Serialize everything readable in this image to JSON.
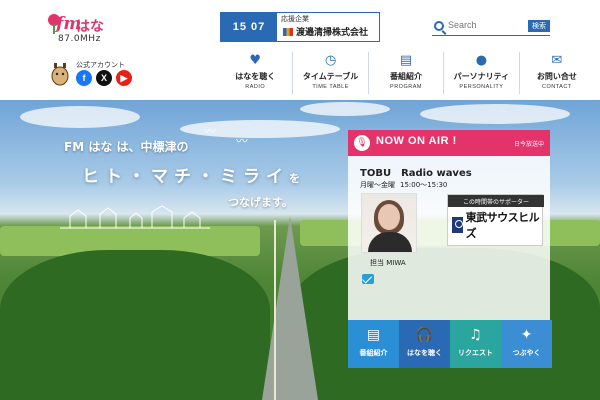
{
  "header": {
    "logo": {
      "brand": "fm",
      "name": "はな",
      "frequency": "87.0MHz"
    },
    "social_label": "公式アカウント",
    "social": [
      {
        "icon": "facebook-icon",
        "glyph": "f",
        "color": "#1877f2"
      },
      {
        "icon": "x-icon",
        "glyph": "X",
        "color": "#111111"
      },
      {
        "icon": "youtube-icon",
        "glyph": "▶",
        "color": "#e62117"
      }
    ],
    "sponsor": {
      "time": "15 07",
      "label": "応援企業",
      "name": "渡邉清掃株式会社"
    },
    "search": {
      "placeholder": "Search",
      "button": "検索"
    },
    "nav": [
      {
        "icon": "heart-icon",
        "glyph": "♥",
        "label": "はなを聴く",
        "sub": "RADIO"
      },
      {
        "icon": "clock-icon",
        "glyph": "◷",
        "label": "タイムテーブル",
        "sub": "TIME TABLE"
      },
      {
        "icon": "program-icon",
        "glyph": "▤",
        "label": "番組紹介",
        "sub": "PROGRAM"
      },
      {
        "icon": "person-icon",
        "glyph": "●",
        "label": "パーソナリティ",
        "sub": "PERSONALITY"
      },
      {
        "icon": "mail-icon",
        "glyph": "✉",
        "label": "お問い合せ",
        "sub": "CONTACT"
      }
    ]
  },
  "hero": {
    "tagline1": "FM はな は、中標津の",
    "tagline2": "ヒト・マチ・ミライ",
    "tagline2_suffix": "を",
    "tagline3": "つなげます。"
  },
  "onair": {
    "title": "NOW ON AIR !",
    "today": "日今放送中",
    "program": "TOBU　Radio waves",
    "days": "月曜〜金曜",
    "time": "15:00〜15:30",
    "host": "担当 MIWA",
    "supporter_label": "この時間帯のサポーター",
    "supporter_name": "東武サウスヒルズ"
  },
  "actions": [
    {
      "icon": "program-icon",
      "glyph": "▤",
      "label": "番組紹介"
    },
    {
      "icon": "headphones-icon",
      "glyph": "🎧",
      "label": "はなを聴く"
    },
    {
      "icon": "music-note-icon",
      "glyph": "♫",
      "label": "リクエスト"
    },
    {
      "icon": "twitter-icon",
      "glyph": "✦",
      "label": "つぶやく"
    }
  ],
  "colors": {
    "accent": "#e3336b",
    "brand_blue": "#2a6ab4"
  }
}
